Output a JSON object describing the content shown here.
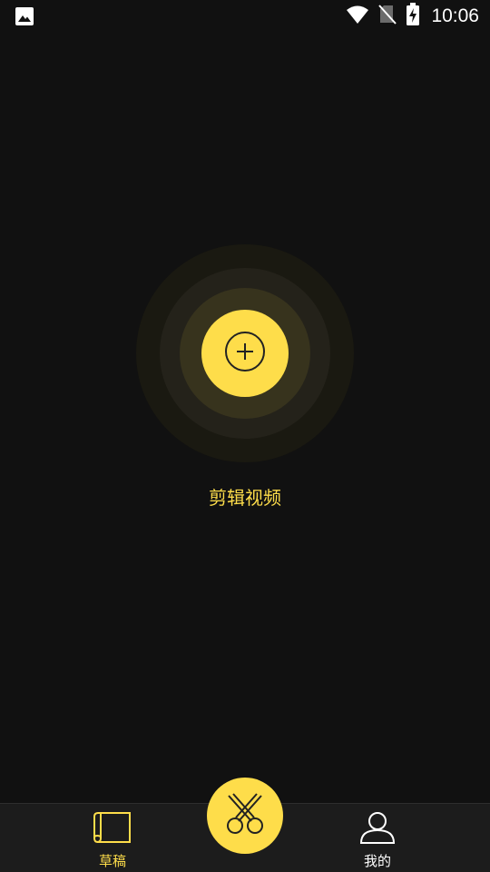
{
  "status_bar": {
    "time": "10:06",
    "left_icon": "image-icon",
    "right_icons": [
      "wifi-icon",
      "no-sim-icon",
      "battery-charging-icon"
    ]
  },
  "main": {
    "add_button_icon": "plus-circle-icon",
    "edit_video_label": "剪辑视频"
  },
  "bottom_nav": {
    "drafts": {
      "label": "草稿",
      "icon": "draft-book-icon",
      "active": true
    },
    "center": {
      "icon": "scissors-icon"
    },
    "mine": {
      "label": "我的",
      "icon": "user-icon",
      "active": false
    }
  },
  "colors": {
    "accent": "#fedd4a",
    "background": "#111111",
    "nav_background": "#1c1c1c"
  }
}
